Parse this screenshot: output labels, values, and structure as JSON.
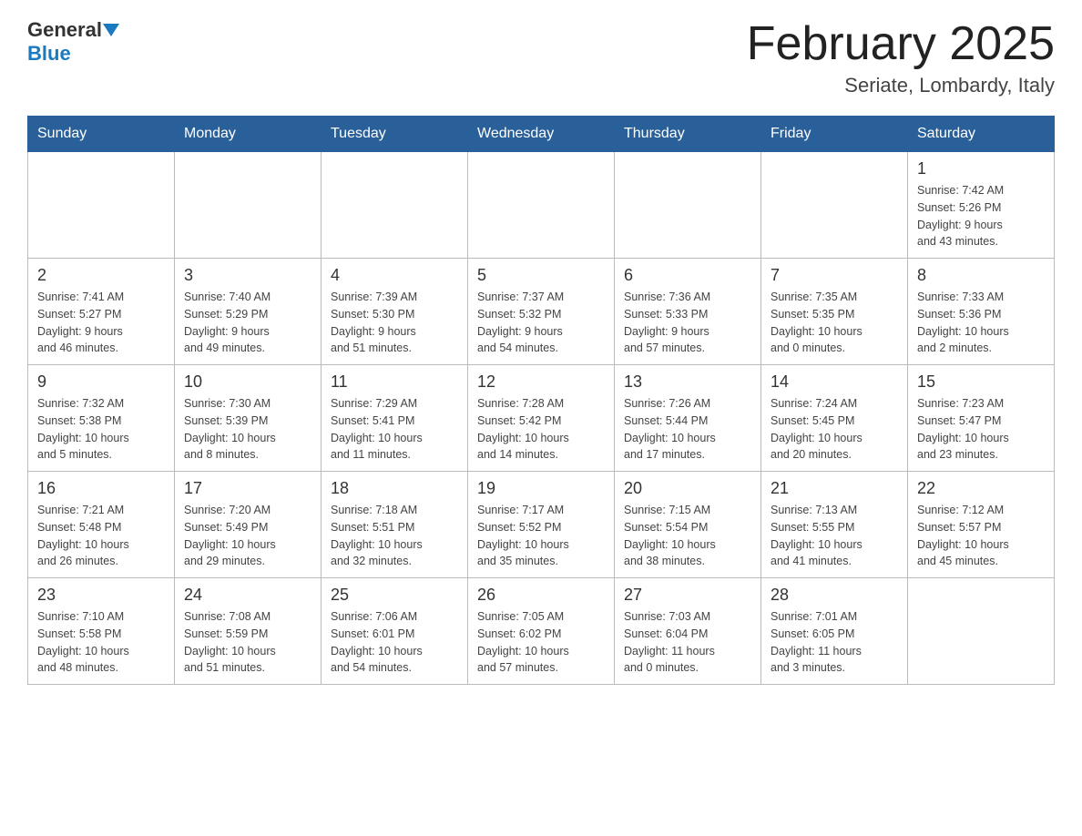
{
  "header": {
    "logo": {
      "general": "General",
      "blue": "Blue",
      "triangle_color": "#1a7abf"
    },
    "title": "February 2025",
    "subtitle": "Seriate, Lombardy, Italy"
  },
  "weekdays": [
    "Sunday",
    "Monday",
    "Tuesday",
    "Wednesday",
    "Thursday",
    "Friday",
    "Saturday"
  ],
  "weeks": [
    {
      "days": [
        {
          "num": "",
          "info": ""
        },
        {
          "num": "",
          "info": ""
        },
        {
          "num": "",
          "info": ""
        },
        {
          "num": "",
          "info": ""
        },
        {
          "num": "",
          "info": ""
        },
        {
          "num": "",
          "info": ""
        },
        {
          "num": "1",
          "info": "Sunrise: 7:42 AM\nSunset: 5:26 PM\nDaylight: 9 hours\nand 43 minutes."
        }
      ]
    },
    {
      "days": [
        {
          "num": "2",
          "info": "Sunrise: 7:41 AM\nSunset: 5:27 PM\nDaylight: 9 hours\nand 46 minutes."
        },
        {
          "num": "3",
          "info": "Sunrise: 7:40 AM\nSunset: 5:29 PM\nDaylight: 9 hours\nand 49 minutes."
        },
        {
          "num": "4",
          "info": "Sunrise: 7:39 AM\nSunset: 5:30 PM\nDaylight: 9 hours\nand 51 minutes."
        },
        {
          "num": "5",
          "info": "Sunrise: 7:37 AM\nSunset: 5:32 PM\nDaylight: 9 hours\nand 54 minutes."
        },
        {
          "num": "6",
          "info": "Sunrise: 7:36 AM\nSunset: 5:33 PM\nDaylight: 9 hours\nand 57 minutes."
        },
        {
          "num": "7",
          "info": "Sunrise: 7:35 AM\nSunset: 5:35 PM\nDaylight: 10 hours\nand 0 minutes."
        },
        {
          "num": "8",
          "info": "Sunrise: 7:33 AM\nSunset: 5:36 PM\nDaylight: 10 hours\nand 2 minutes."
        }
      ]
    },
    {
      "days": [
        {
          "num": "9",
          "info": "Sunrise: 7:32 AM\nSunset: 5:38 PM\nDaylight: 10 hours\nand 5 minutes."
        },
        {
          "num": "10",
          "info": "Sunrise: 7:30 AM\nSunset: 5:39 PM\nDaylight: 10 hours\nand 8 minutes."
        },
        {
          "num": "11",
          "info": "Sunrise: 7:29 AM\nSunset: 5:41 PM\nDaylight: 10 hours\nand 11 minutes."
        },
        {
          "num": "12",
          "info": "Sunrise: 7:28 AM\nSunset: 5:42 PM\nDaylight: 10 hours\nand 14 minutes."
        },
        {
          "num": "13",
          "info": "Sunrise: 7:26 AM\nSunset: 5:44 PM\nDaylight: 10 hours\nand 17 minutes."
        },
        {
          "num": "14",
          "info": "Sunrise: 7:24 AM\nSunset: 5:45 PM\nDaylight: 10 hours\nand 20 minutes."
        },
        {
          "num": "15",
          "info": "Sunrise: 7:23 AM\nSunset: 5:47 PM\nDaylight: 10 hours\nand 23 minutes."
        }
      ]
    },
    {
      "days": [
        {
          "num": "16",
          "info": "Sunrise: 7:21 AM\nSunset: 5:48 PM\nDaylight: 10 hours\nand 26 minutes."
        },
        {
          "num": "17",
          "info": "Sunrise: 7:20 AM\nSunset: 5:49 PM\nDaylight: 10 hours\nand 29 minutes."
        },
        {
          "num": "18",
          "info": "Sunrise: 7:18 AM\nSunset: 5:51 PM\nDaylight: 10 hours\nand 32 minutes."
        },
        {
          "num": "19",
          "info": "Sunrise: 7:17 AM\nSunset: 5:52 PM\nDaylight: 10 hours\nand 35 minutes."
        },
        {
          "num": "20",
          "info": "Sunrise: 7:15 AM\nSunset: 5:54 PM\nDaylight: 10 hours\nand 38 minutes."
        },
        {
          "num": "21",
          "info": "Sunrise: 7:13 AM\nSunset: 5:55 PM\nDaylight: 10 hours\nand 41 minutes."
        },
        {
          "num": "22",
          "info": "Sunrise: 7:12 AM\nSunset: 5:57 PM\nDaylight: 10 hours\nand 45 minutes."
        }
      ]
    },
    {
      "days": [
        {
          "num": "23",
          "info": "Sunrise: 7:10 AM\nSunset: 5:58 PM\nDaylight: 10 hours\nand 48 minutes."
        },
        {
          "num": "24",
          "info": "Sunrise: 7:08 AM\nSunset: 5:59 PM\nDaylight: 10 hours\nand 51 minutes."
        },
        {
          "num": "25",
          "info": "Sunrise: 7:06 AM\nSunset: 6:01 PM\nDaylight: 10 hours\nand 54 minutes."
        },
        {
          "num": "26",
          "info": "Sunrise: 7:05 AM\nSunset: 6:02 PM\nDaylight: 10 hours\nand 57 minutes."
        },
        {
          "num": "27",
          "info": "Sunrise: 7:03 AM\nSunset: 6:04 PM\nDaylight: 11 hours\nand 0 minutes."
        },
        {
          "num": "28",
          "info": "Sunrise: 7:01 AM\nSunset: 6:05 PM\nDaylight: 11 hours\nand 3 minutes."
        },
        {
          "num": "",
          "info": ""
        }
      ]
    }
  ]
}
